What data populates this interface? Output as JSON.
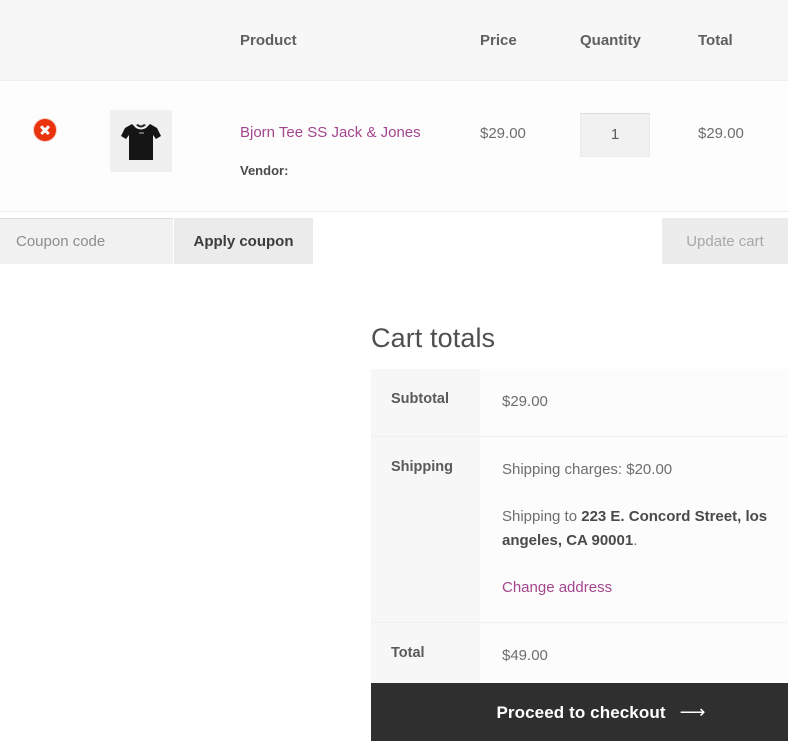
{
  "cart_table": {
    "headers": {
      "remove": "",
      "thumbnail": "",
      "product": "Product",
      "price": "Price",
      "quantity": "Quantity",
      "total": "Total"
    },
    "rows": [
      {
        "remove_icon": "remove-circle-icon",
        "thumbnail_icon": "tshirt-thumbnail",
        "product_name": "Bjorn Tee SS Jack & Jones",
        "vendor_label": "Vendor:",
        "price": "$29.00",
        "quantity": "1",
        "total": "$29.00"
      }
    ]
  },
  "coupon": {
    "placeholder": "Coupon code",
    "value": "",
    "apply_label": "Apply coupon",
    "update_label": "Update cart"
  },
  "cart_totals": {
    "heading": "Cart totals",
    "subtotal_label": "Subtotal",
    "subtotal_value": "$29.00",
    "shipping_label": "Shipping",
    "shipping_charges": "Shipping charges: $20.00",
    "shipping_to_prefix": "Shipping to ",
    "shipping_address": "223 E. Concord Street, los angeles, CA 90001",
    "shipping_to_suffix": ".",
    "change_address_label": "Change address",
    "total_label": "Total",
    "total_value": "$49.00"
  },
  "checkout": {
    "label": "Proceed to checkout",
    "arrow": "⟶"
  },
  "colors": {
    "link": "#a4468e",
    "remove": "#e8330d",
    "checkout_bg": "#2f2f2f",
    "header_bg": "#f7f7f7",
    "label_bg": "#f7f7f7"
  }
}
